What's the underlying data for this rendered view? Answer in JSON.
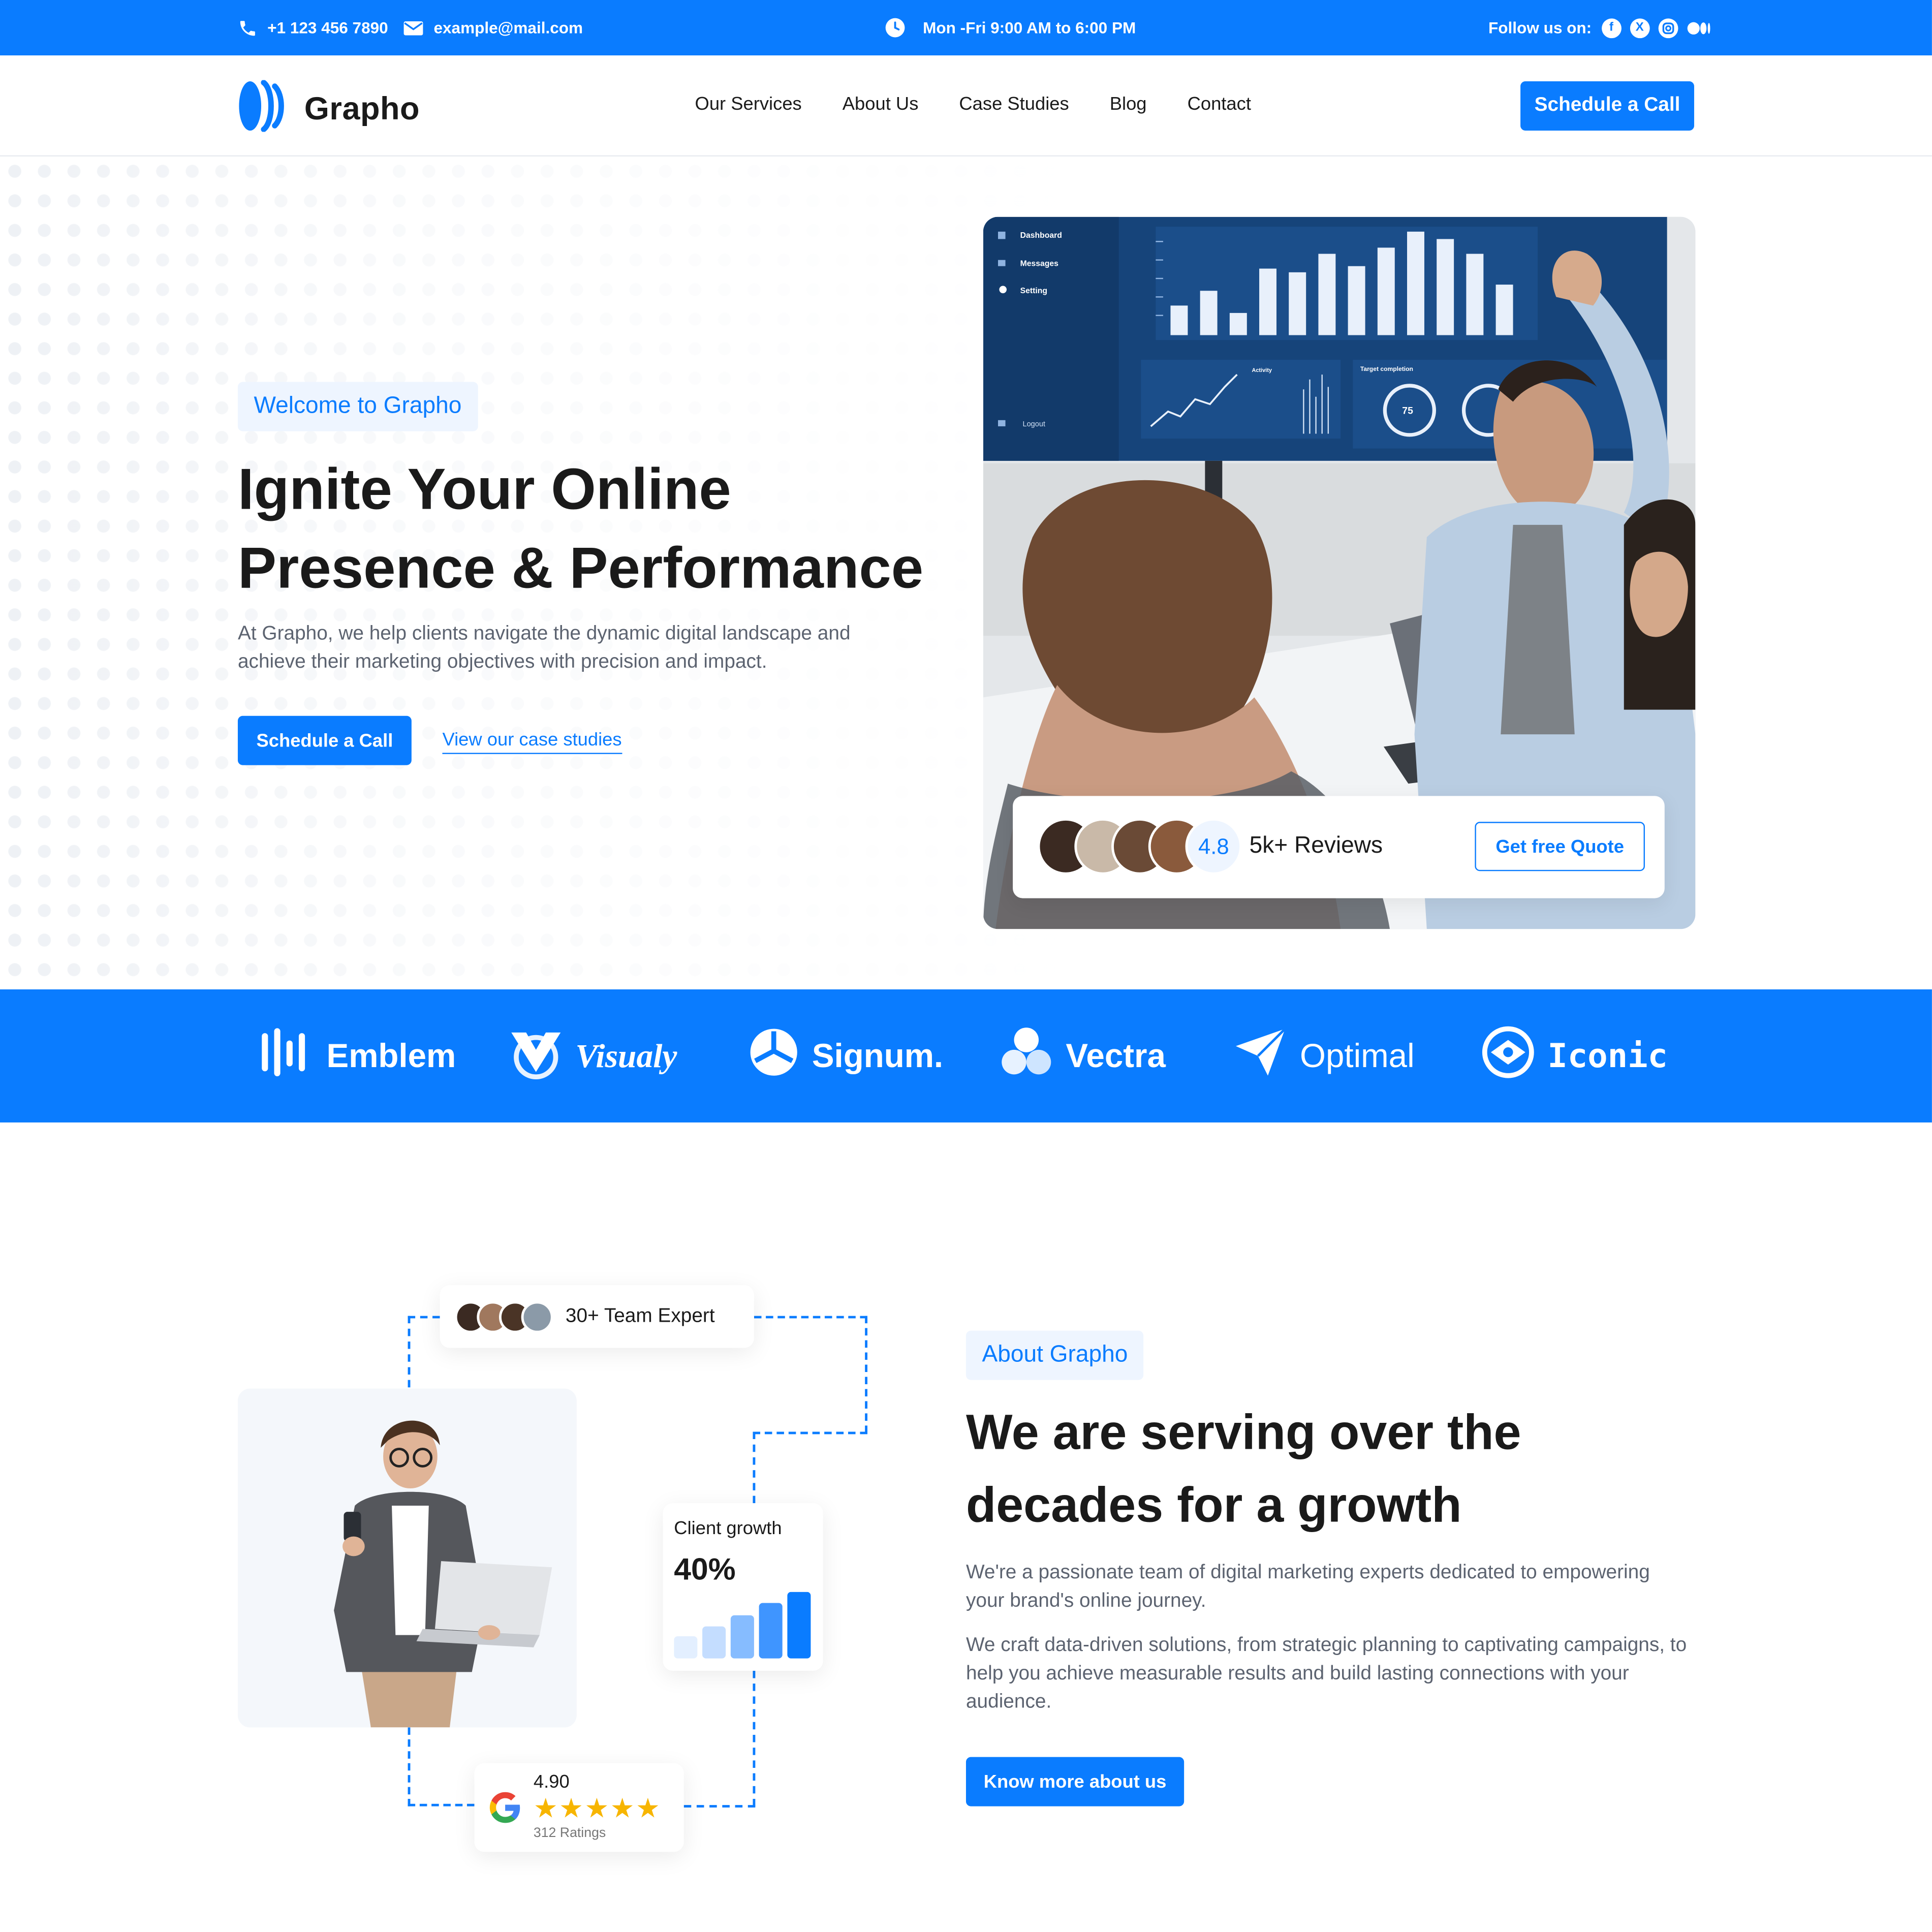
{
  "topbar": {
    "phone": "+1 123 456 7890",
    "email": "example@mail.com",
    "hours": "Mon -Fri 9:00 AM to 6:00 PM",
    "follow_label": "Follow us on:",
    "socials": [
      "facebook-icon",
      "x-icon",
      "instagram-icon",
      "medium-icon"
    ]
  },
  "nav": {
    "brand": "Grapho",
    "items": [
      "Our Services",
      "About Us",
      "Case Studies",
      "Blog",
      "Contact"
    ],
    "cta": "Schedule a Call"
  },
  "hero": {
    "tag": "Welcome to Grapho",
    "title_line1": "Ignite Your Online",
    "title_line2": "Presence & Performance",
    "description": "At Grapho, we help clients navigate the dynamic digital landscape and achieve their marketing objectives with precision and impact.",
    "primary_cta": "Schedule a Call",
    "secondary_cta": "View our case studies",
    "review_card": {
      "rating": "4.8",
      "reviews": "5k+ Reviews",
      "quote_button": "Get free Quote"
    },
    "dashboard": {
      "menu": [
        "Dashboard",
        "Messages",
        "Setting"
      ],
      "logout": "Logout",
      "activity_label": "Activity",
      "target_label": "Target completion",
      "target_value": "75"
    }
  },
  "brands": [
    "Emblem",
    "Visualy",
    "Signum.",
    "Vectra",
    "Optimal",
    "Iconic"
  ],
  "about": {
    "team_badge": "30+ Team Expert",
    "growth_label": "Client growth",
    "growth_value": "40%",
    "rating_value": "4.90",
    "rating_count": "312 Ratings",
    "tag": "About Grapho",
    "title_line1": "We are serving over the",
    "title_line2": "decades for a growth",
    "para1": "We're a passionate team of digital marketing experts dedicated to empowering your brand's online journey.",
    "para2": "We craft data-driven solutions, from strategic planning to captivating campaigns, to help you achieve measurable results and build lasting connections with your audience.",
    "cta": "Know more about us"
  },
  "colors": {
    "accent": "#0a7cff",
    "text": "#1a1a1a",
    "muted": "#5c6370",
    "star": "#f7b500"
  }
}
